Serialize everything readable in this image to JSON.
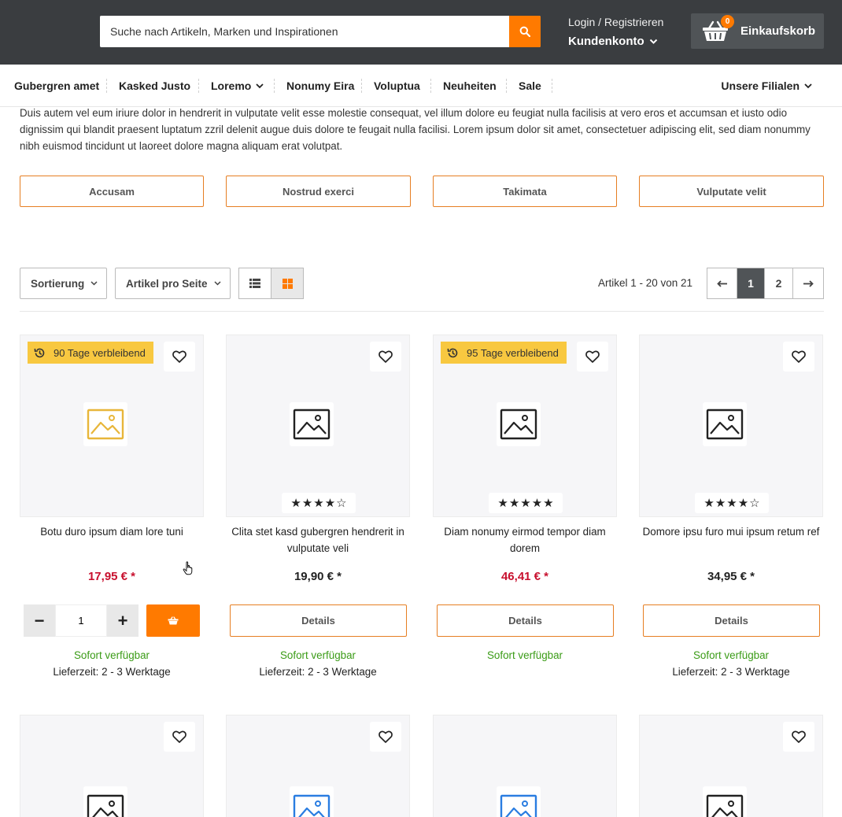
{
  "header": {
    "search_placeholder": "Suche nach Artikeln, Marken und Inspirationen",
    "login_label": "Login / Registrieren",
    "account_label": "Kundenkonto",
    "cart_count": "0",
    "cart_label": "Einkaufskorb",
    "accent_color": "#ff7a00"
  },
  "nav": {
    "items": [
      {
        "label": "Gubergren amet"
      },
      {
        "label": "Kasked Justo"
      },
      {
        "label": "Loremo"
      },
      {
        "label": "Nonumy Eira"
      },
      {
        "label": "Voluptua"
      },
      {
        "label": "Neuheiten"
      },
      {
        "label": "Sale"
      }
    ],
    "filialen": "Unsere Filialen"
  },
  "description": "Duis autem vel eum iriure dolor in hendrerit in vulputate velit esse molestie consequat, vel illum dolore eu feugiat nulla facilisis at vero eros et accumsan et iusto odio dignissim qui blandit praesent luptatum zzril delenit augue duis dolore te feugait nulla facilisi. Lorem ipsum dolor sit amet, consectetuer adipiscing elit, sed diam nonummy nibh euismod tincidunt ut laoreet dolore magna aliquam erat volutpat.",
  "categories": [
    {
      "label": "Accusam"
    },
    {
      "label": "Nostrud exerci"
    },
    {
      "label": "Takimata"
    },
    {
      "label": "Vulputate velit"
    }
  ],
  "toolbar": {
    "sort_label": "Sortierung",
    "per_page_label": "Artikel pro Seite",
    "counter": "Artikel 1 - 20 von 21",
    "pages": [
      "1",
      "2"
    ],
    "active_page": "1"
  },
  "products": [
    {
      "title": "Botu duro ipsum diam lore tuni",
      "price": "17,95 € *",
      "price_red": true,
      "badge": "90 Tage verbleibend",
      "rating": 0,
      "qty": "1",
      "availability": "Sofort verfügbar",
      "delivery": "Lieferzeit: 2 - 3 Werktage",
      "image_icon_color": "#e8b63a"
    },
    {
      "title": "Clita stet kasd gubergren hendrerit in vulputate veli",
      "price": "19,90 € *",
      "price_red": false,
      "badge": "",
      "rating": 4,
      "button": "Details",
      "availability": "Sofort verfügbar",
      "delivery": "Lieferzeit: 2 - 3 Werktage",
      "image_icon_color": "#222222"
    },
    {
      "title": "Diam nonumy eirmod tempor diam dorem",
      "price": "46,41 € *",
      "price_red": true,
      "badge": "95 Tage verbleibend",
      "rating": 5,
      "button": "Details",
      "availability": "Sofort verfügbar",
      "delivery": "",
      "image_icon_color": "#222222"
    },
    {
      "title": "Domore ipsu furo mui ipsum retum ref",
      "price": "34,95 € *",
      "price_red": false,
      "badge": "",
      "rating": 4,
      "button": "Details",
      "availability": "Sofort verfügbar",
      "delivery": "Lieferzeit: 2 - 3 Werktage",
      "image_icon_color": "#222222"
    }
  ],
  "row2_icon_colors": [
    "#222222",
    "#2a7de1",
    "#2a7de1",
    "#222222"
  ]
}
